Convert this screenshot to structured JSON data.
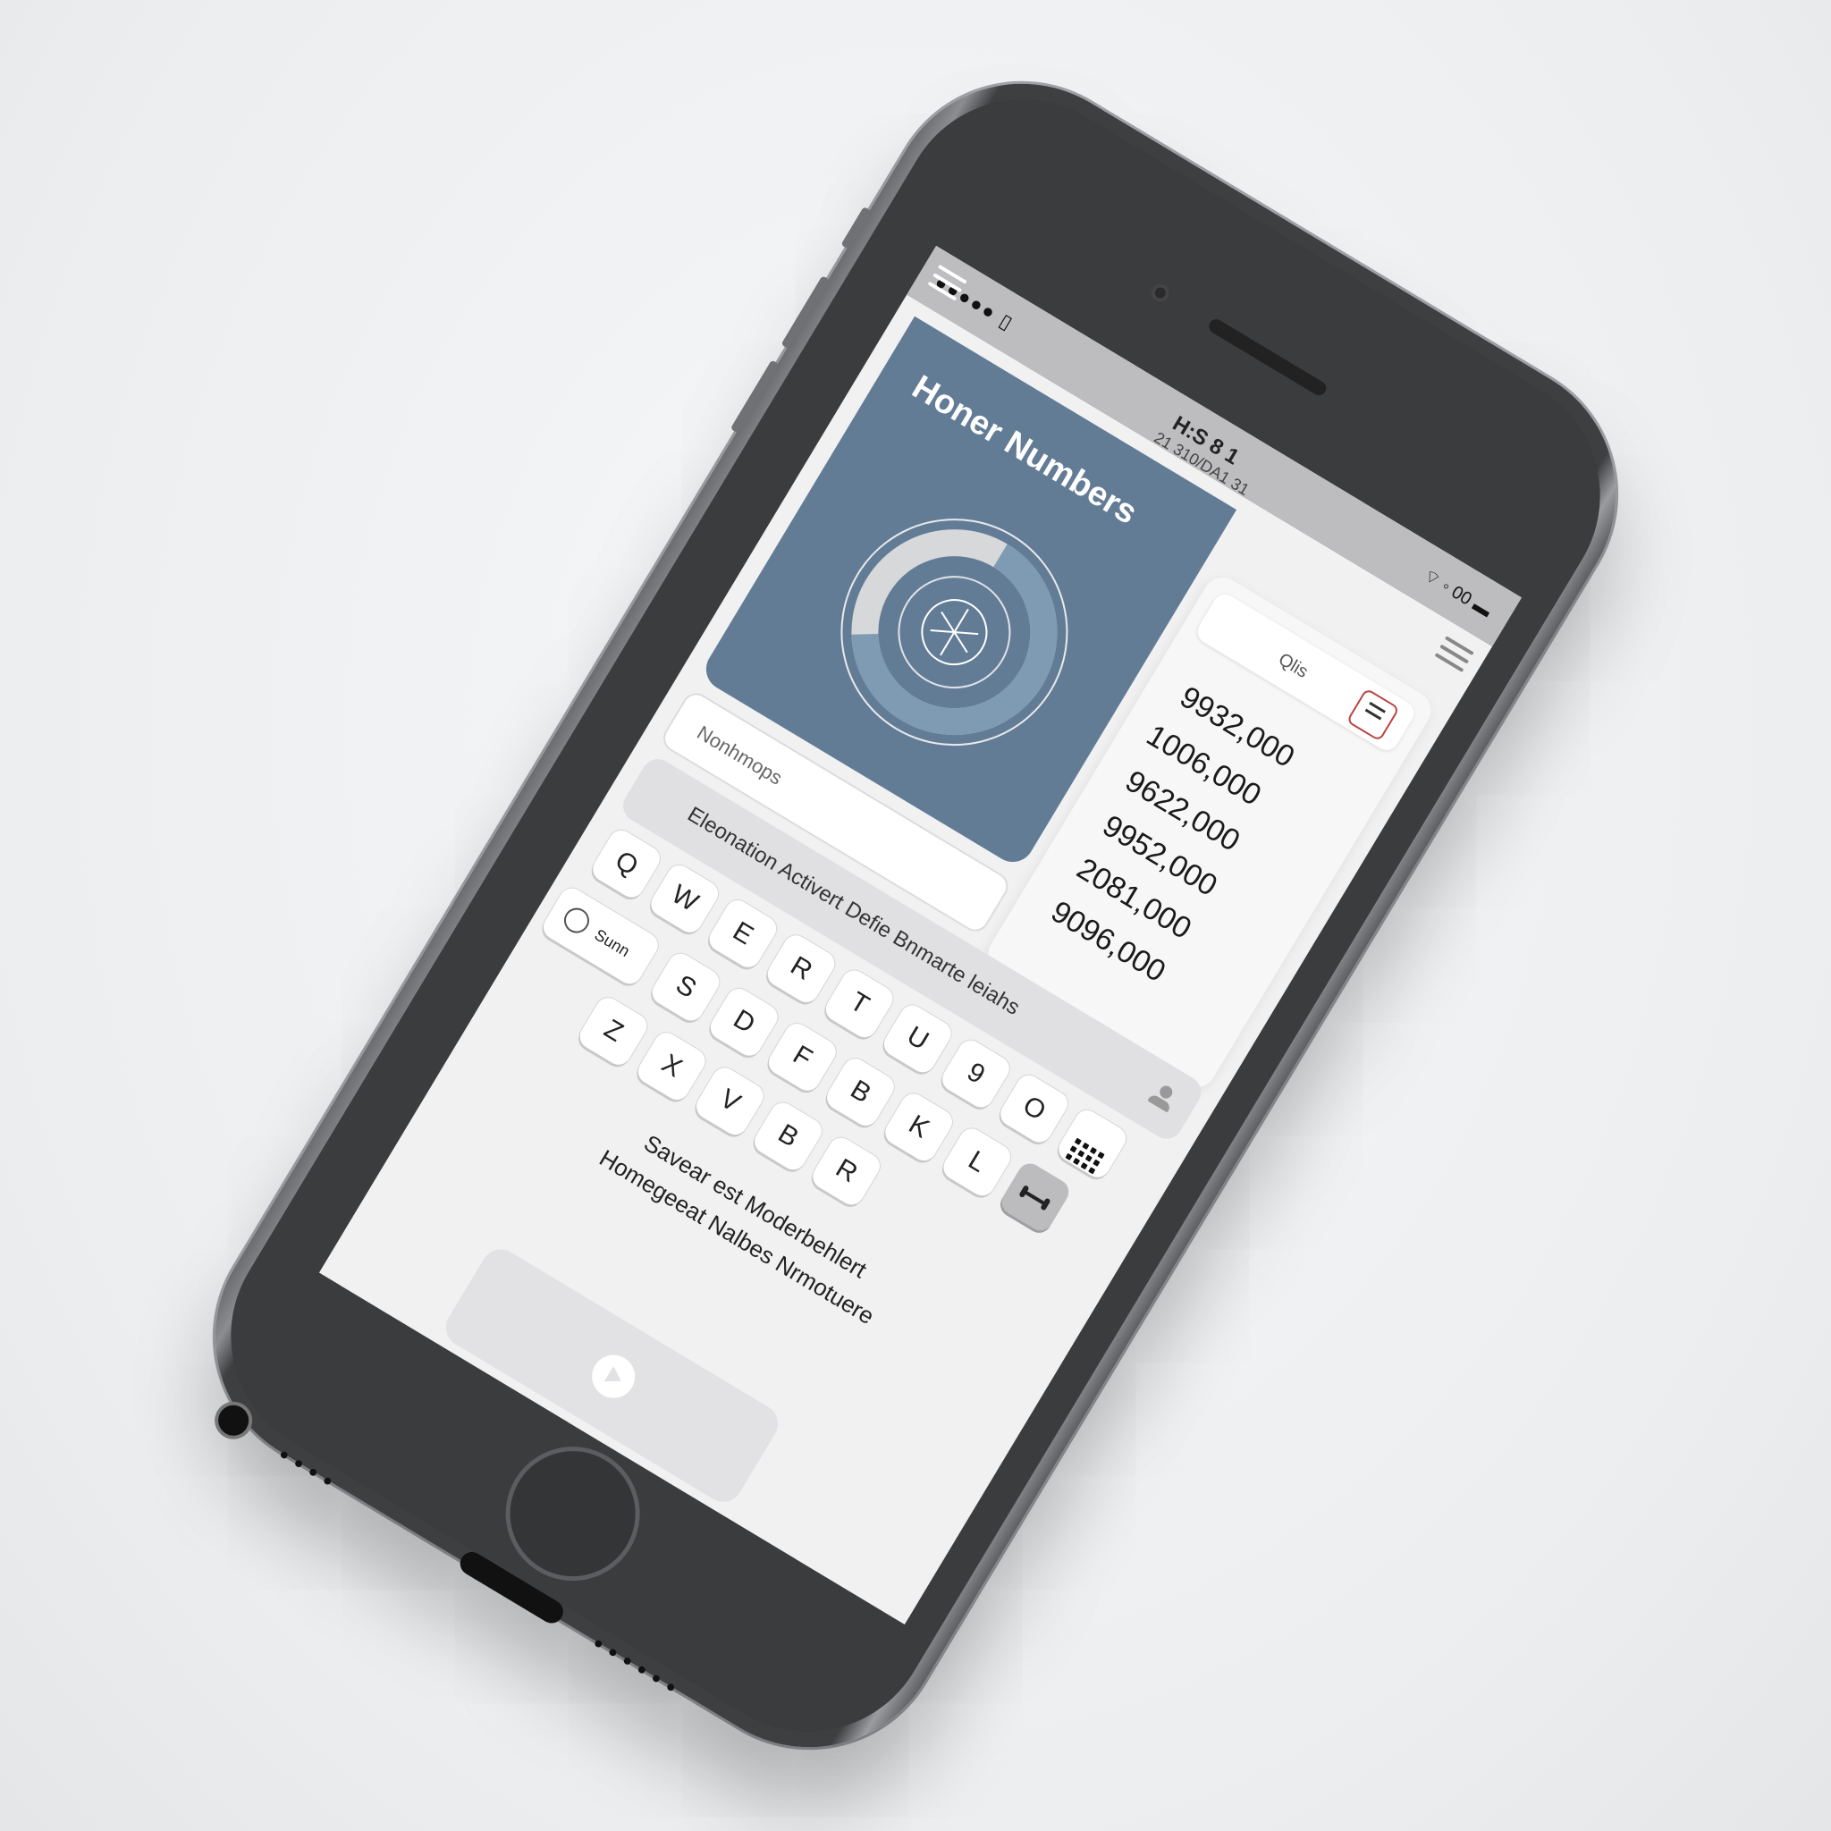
{
  "status_bar": {
    "signal": "●●●●● ▯",
    "time": "H:S 8 1",
    "carrier": "21 310/DA1 31",
    "right_icons": "⌔ ◦ 00 ▬"
  },
  "hero": {
    "title": "Honer Numbers",
    "ring_fill_fraction": 0.66,
    "ring_colors": {
      "track": "#d7d8da",
      "fill": "#7f9ab3",
      "center": "#637c96"
    }
  },
  "panel": {
    "tab_label": "Qlis",
    "numbers": [
      "9932,000",
      "1006,000",
      "9622,000",
      "9952,000",
      "2081,000",
      "9096,000"
    ]
  },
  "field": {
    "placeholder": "Nonhmops"
  },
  "info_bar": {
    "text": "Eleonation Activert Defie Bnmarte leiahs"
  },
  "keyboard": {
    "row1": [
      "Q",
      "W",
      "E",
      "R",
      "T",
      "U",
      "9",
      "O"
    ],
    "row2_special": "Sunn",
    "row2": [
      "S",
      "D",
      "F",
      "B",
      "K",
      "L"
    ],
    "row3": [
      "Z",
      "X",
      "V",
      "B",
      "R"
    ],
    "icons": {
      "grid": "keypad-icon",
      "dash": "connector-icon"
    }
  },
  "footer": {
    "line1": "Savear est Moderbehlert",
    "line2": "Homegeeat Nalbes Nrmotuere"
  },
  "colors": {
    "accent": "#637c96",
    "screen_bg": "#f1f1f2",
    "phone_body": "#3b3c3e"
  }
}
